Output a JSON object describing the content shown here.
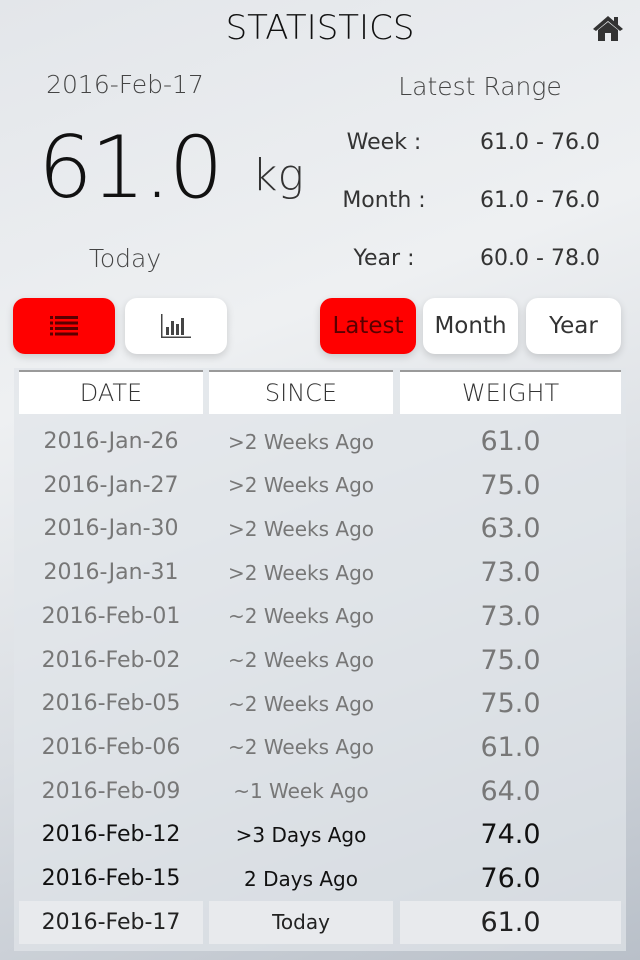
{
  "header": {
    "title": "STATISTICS",
    "home_icon": "home-icon"
  },
  "summary": {
    "date": "2016-Feb-17",
    "weight": "61.0",
    "unit": "kg",
    "label": "Today"
  },
  "range": {
    "title": "Latest Range",
    "rows": [
      {
        "label": "Week :",
        "value": "61.0 - 76.0"
      },
      {
        "label": "Month :",
        "value": "61.0 - 76.0"
      },
      {
        "label": "Year :",
        "value": "60.0 - 78.0"
      }
    ]
  },
  "view_toggle": {
    "list_icon": "list-icon",
    "chart_icon": "bar-chart-icon",
    "active": "list"
  },
  "period_tabs": {
    "items": [
      {
        "label": "Latest",
        "active": true
      },
      {
        "label": "Month",
        "active": false
      },
      {
        "label": "Year",
        "active": false
      }
    ]
  },
  "colors": {
    "accent": "#ff0000"
  },
  "table": {
    "columns": [
      "DATE",
      "SINCE",
      "WEIGHT"
    ],
    "rows": [
      {
        "date": "2016-Jan-26",
        "since": ">2 Weeks Ago",
        "weight": "61.0"
      },
      {
        "date": "2016-Jan-27",
        "since": ">2 Weeks Ago",
        "weight": "75.0"
      },
      {
        "date": "2016-Jan-30",
        "since": ">2 Weeks Ago",
        "weight": "63.0"
      },
      {
        "date": "2016-Jan-31",
        "since": ">2 Weeks Ago",
        "weight": "73.0"
      },
      {
        "date": "2016-Feb-01",
        "since": "~2 Weeks Ago",
        "weight": "73.0"
      },
      {
        "date": "2016-Feb-02",
        "since": "~2 Weeks Ago",
        "weight": "75.0"
      },
      {
        "date": "2016-Feb-05",
        "since": "~2 Weeks Ago",
        "weight": "75.0"
      },
      {
        "date": "2016-Feb-06",
        "since": "~2 Weeks Ago",
        "weight": "61.0"
      },
      {
        "date": "2016-Feb-09",
        "since": "~1 Week Ago",
        "weight": "64.0"
      },
      {
        "date": "2016-Feb-12",
        "since": ">3 Days Ago",
        "weight": "74.0"
      },
      {
        "date": "2016-Feb-15",
        "since": "2 Days Ago",
        "weight": "76.0"
      },
      {
        "date": "2016-Feb-17",
        "since": "Today",
        "weight": "61.0"
      }
    ]
  }
}
